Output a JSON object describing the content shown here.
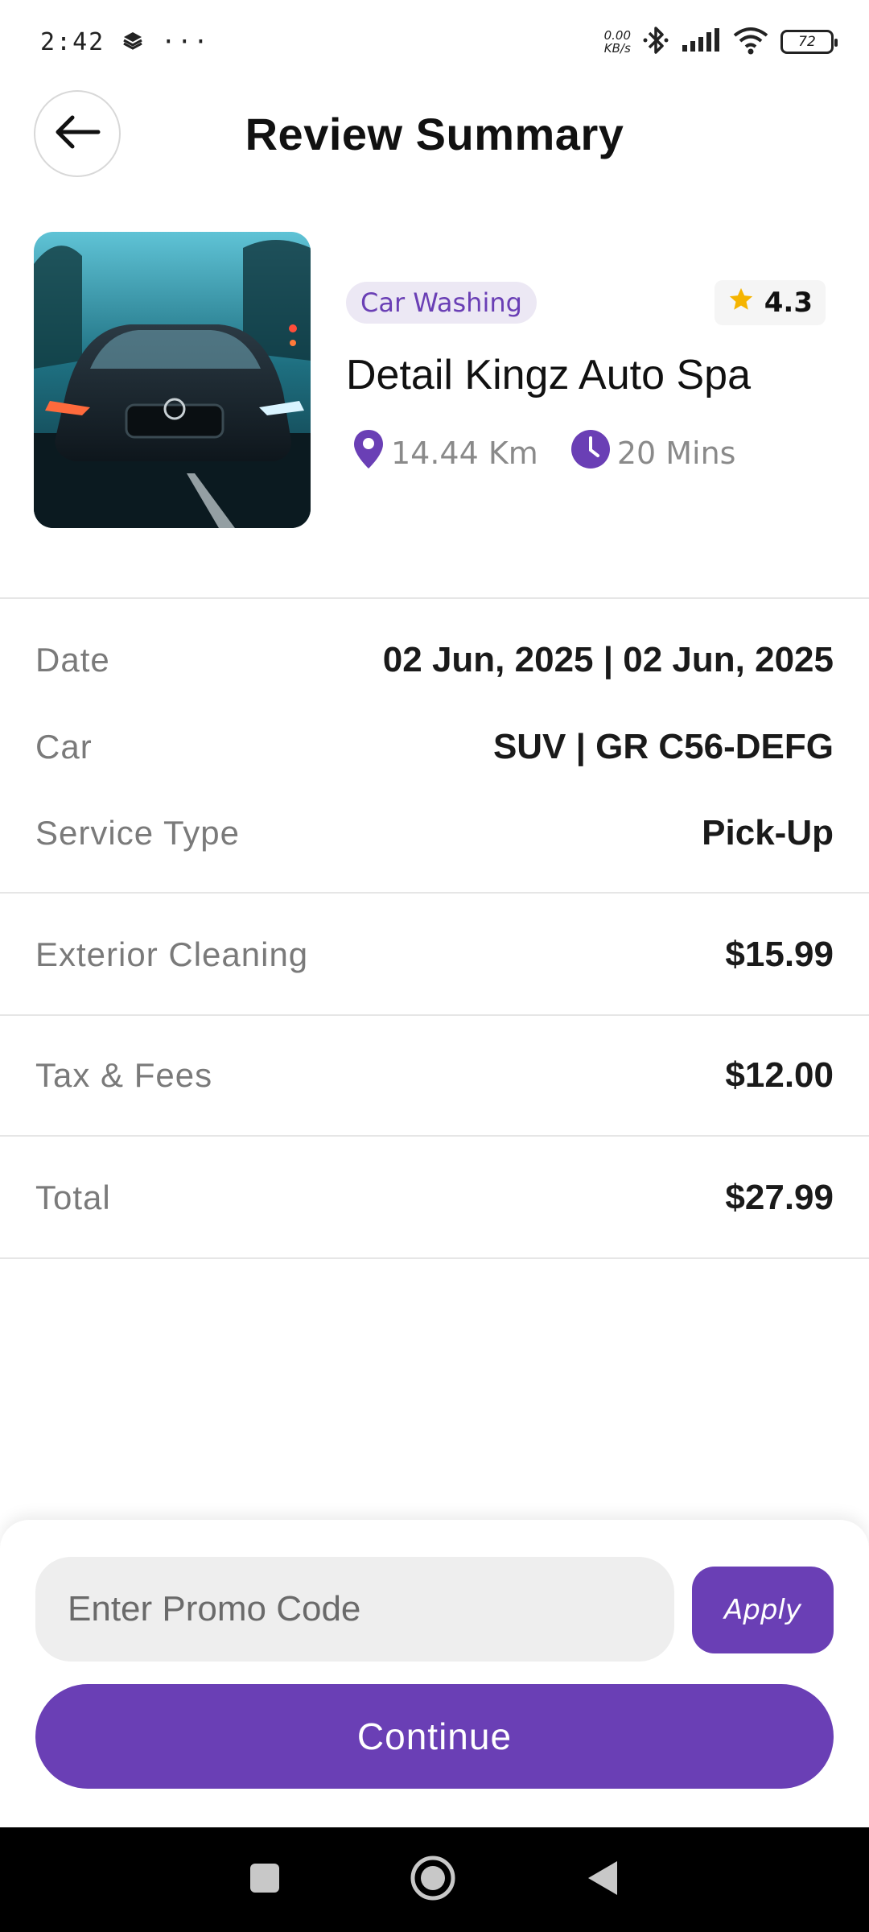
{
  "status_bar": {
    "time": "2:42",
    "dots": "···",
    "net_speed_value": "0.00",
    "net_speed_unit": "KB/s",
    "battery": "72"
  },
  "header": {
    "title": "Review Summary"
  },
  "service": {
    "category": "Car Washing",
    "rating": "4.3",
    "name": "Detail Kingz Auto Spa",
    "distance": "14.44 Km",
    "duration": "20 Mins"
  },
  "details": [
    {
      "label": "Date",
      "value": "02 Jun, 2025 | 02 Jun, 2025"
    },
    {
      "label": "Car",
      "value": "SUV | GR C56-DEFG"
    },
    {
      "label": "Service Type",
      "value": "Pick-Up"
    }
  ],
  "charges": [
    {
      "label": "Exterior Cleaning",
      "value": "$15.99"
    },
    {
      "label": "Tax & Fees",
      "value": "$12.00"
    },
    {
      "label": "Total",
      "value": "$27.99"
    }
  ],
  "promo": {
    "placeholder": "Enter Promo Code",
    "apply_label": "Apply"
  },
  "continue_label": "Continue",
  "colors": {
    "accent": "#6a3fb5",
    "star": "#f5b400",
    "tag_bg": "#ece8f4"
  },
  "icons": {
    "back": "arrow-left-icon",
    "star": "star-icon",
    "location": "location-pin-icon",
    "clock": "clock-icon"
  }
}
